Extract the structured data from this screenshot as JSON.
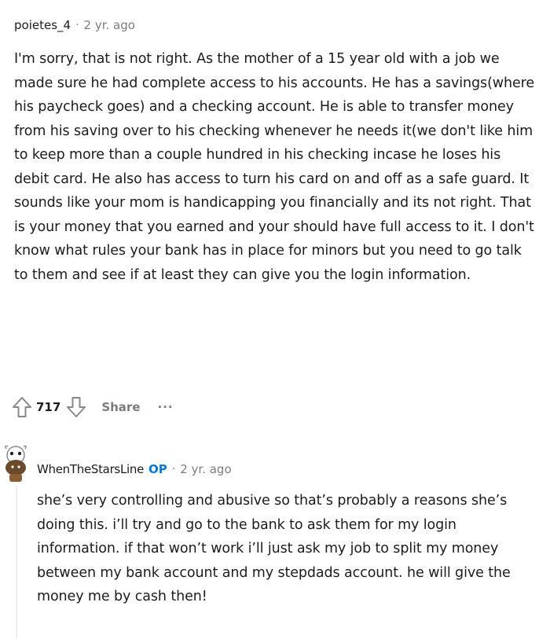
{
  "comment": {
    "author": "poietes_4",
    "separator": "·",
    "age": "2 yr. ago",
    "body": "I'm sorry, that is not right. As the mother of a 15 year old with a job we made sure he had complete access to his accounts. He has a savings(where his paycheck goes) and a checking account. He is able to transfer money from his saving over to his checking whenever he needs it(we don't like him to keep more than a couple hundred in his checking incase he loses his debit card. He also has access to turn his card on and off as a safe guard. It sounds like your mom is handicapping you financially and its not right. That is your money that you earned and your should have full access to it. I don't know what rules your bank has in place for minors but you need to go talk to them and see if at least they can give you the login information.",
    "score": "717",
    "share_label": "Share",
    "more_label": "···",
    "icons": {
      "upvote": "upvote-arrow-icon",
      "downvote": "downvote-arrow-icon"
    }
  },
  "reply": {
    "author": "WhenTheStarsLine",
    "op_badge": "OP",
    "separator": "·",
    "age": "2 yr. ago",
    "body": "she’s very controlling and abusive so that’s probably a reasons she’s doing this. i’ll try and go to the bank to ask them for my login information. if that won’t work i’ll just ask my job to split my money between my bank account and my stepdads account. he will give the money me by cash then!",
    "avatar": "snoo-avatar-icon"
  },
  "colors": {
    "text": "#1c1c1c",
    "meta": "#7c7c7c",
    "op_badge": "#0079d3",
    "thread_line": "#edeff1"
  }
}
